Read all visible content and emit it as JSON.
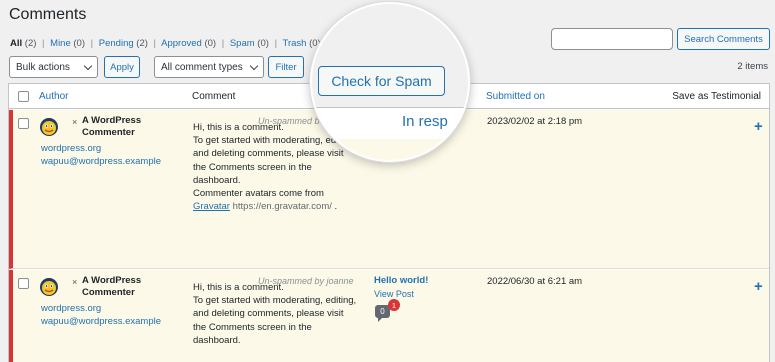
{
  "page": {
    "title": "Comments"
  },
  "filters": {
    "all": "All",
    "all_count": "(2)",
    "mine": "Mine",
    "mine_count": "(0)",
    "pending": "Pending",
    "pending_count": "(2)",
    "approved": "Approved",
    "approved_count": "(0)",
    "spam": "Spam",
    "spam_count": "(0)",
    "trash": "Trash",
    "trash_count": "(0)",
    "separator": "|"
  },
  "search": {
    "value": "",
    "button": "Search Comments"
  },
  "toolbar": {
    "bulk_actions": "Bulk actions",
    "apply": "Apply",
    "comment_types": "All comment types",
    "filter": "Filter",
    "check_spam": "Check for Spam",
    "items": "2 items"
  },
  "columns": {
    "author": "Author",
    "comment": "Comment",
    "in_response_to": "In resp",
    "submitted_on": "Submitted on",
    "testimonial": "Save as Testimonial"
  },
  "rows": [
    {
      "author_x": "×",
      "author_name": "A WordPress Commenter",
      "author_site": "wordpress.org",
      "author_email": "wapuu@wordpress.example",
      "status_note": "Un-spammed b",
      "comment_lines": [
        "Hi, this is a comment.",
        "To get started with moderating, editing, and deleting comments, please visit the Comments screen in the dashboard.",
        "Commenter avatars come from"
      ],
      "gravatar_link": "Gravatar",
      "gravatar_url": "https://en.gravatar.com/",
      "gravatar_end": ".",
      "response_title": "",
      "submitted": "2023/02/02 at 2:18 pm",
      "testimonial_action": "+"
    },
    {
      "author_x": "×",
      "author_name": "A WordPress Commenter",
      "author_site": "wordpress.org",
      "author_email": "wapuu@wordpress.example",
      "status_note": "Un-spammed by joanne",
      "comment_lines": [
        "Hi, this is a comment.",
        "To get started with moderating, editing, and deleting comments, please visit the Comments screen in the dashboard."
      ],
      "response_title": "Hello world!",
      "view_post": "View Post",
      "bubble_count": "0",
      "pending_badge": "1",
      "submitted": "2022/06/30 at 6:21 am",
      "testimonial_action": "+"
    }
  ],
  "colors": {
    "accent": "#2271b1",
    "spam_row_bg": "#fcf9e8",
    "spam_row_border": "#d63638",
    "page_bg": "#f0f0f1"
  }
}
